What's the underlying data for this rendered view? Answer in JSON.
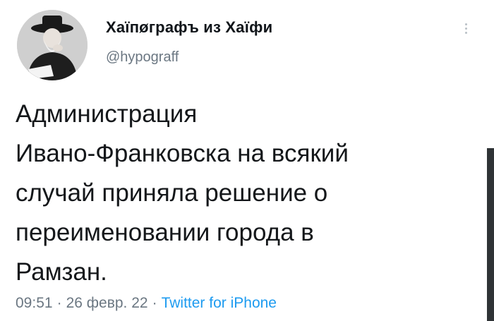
{
  "author": {
    "display_name": "Хаїпøграфъ из Хаїфи",
    "handle": "@hypograff",
    "avatar_icon": "profile-photo"
  },
  "tweet": {
    "lines": [
      "Администрация",
      "Ивано-Франковска на всякий",
      "случай приняла решение о",
      "переименовании города в",
      "Рамзан."
    ]
  },
  "meta": {
    "time": "09:51",
    "date": "26 февр. 22",
    "source": "Twitter for iPhone",
    "separator": "·"
  },
  "colors": {
    "text": "#14171a",
    "secondary": "#6b7782",
    "link": "#1d9bf0",
    "background": "#ffffff"
  }
}
